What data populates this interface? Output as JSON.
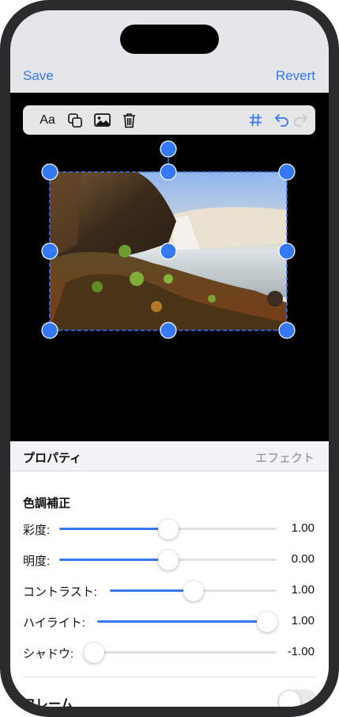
{
  "nav": {
    "save_label": "Save",
    "revert_label": "Revert"
  },
  "toolbar": {
    "text_label": "Aa"
  },
  "icons": [
    "text-format-icon",
    "duplicate-icon",
    "image-icon",
    "trash-icon",
    "grid-icon",
    "undo-icon",
    "redo-icon"
  ],
  "colors": {
    "accent": "#3478f6",
    "nav_bg": "#e5e5ea",
    "canvas_bg": "#000000",
    "panel_bg": "#ffffff"
  },
  "panel": {
    "title": "プロパティ",
    "tab": "エフェクト",
    "section_title": "色調補正",
    "sliders": [
      {
        "label": "彩度:",
        "value": "1.00",
        "position": 0.5
      },
      {
        "label": "明度:",
        "value": "0.00",
        "position": 0.5
      },
      {
        "label": "コントラスト:",
        "value": "1.00",
        "position": 0.5
      },
      {
        "label": "ハイライト:",
        "value": "1.00",
        "position": 1.0
      },
      {
        "label": "シャドウ:",
        "value": "-1.00",
        "position": 0.0
      }
    ],
    "frame_label": "フレーム",
    "frame_enabled": false
  }
}
